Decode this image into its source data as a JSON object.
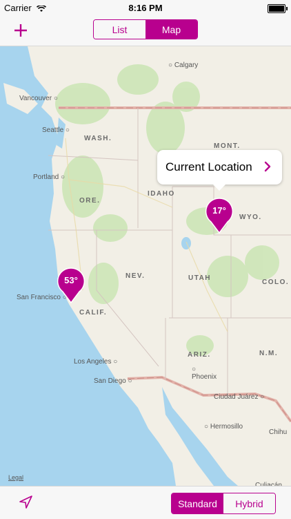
{
  "status": {
    "carrier": "Carrier",
    "time": "8:16 PM"
  },
  "nav": {
    "tab_list": "List",
    "tab_map": "Map"
  },
  "map": {
    "callout": "Current Location",
    "pins": [
      {
        "temp": "17°"
      },
      {
        "temp": "53°"
      }
    ],
    "states": [
      "WASH.",
      "MONT.",
      "IDAHO",
      "ORE.",
      "WYO.",
      "NEV.",
      "UTAH",
      "COLO.",
      "CALIF.",
      "ARIZ.",
      "N.M."
    ],
    "cities": [
      "Calgary",
      "Vancouver",
      "Seattle",
      "Portland",
      "San Francisco",
      "Los Angeles",
      "San Diego",
      "Phoenix",
      "Ciudad Juárez",
      "Hermosillo",
      "Chihu",
      "Culiacán"
    ],
    "legal": "Legal"
  },
  "bottom": {
    "standard": "Standard",
    "hybrid": "Hybrid"
  },
  "colors": {
    "accent": "#b8008e",
    "water": "#a7d4ee",
    "land": "#f2efe6",
    "park": "#cde6b7",
    "border": "#e3b3aa"
  }
}
